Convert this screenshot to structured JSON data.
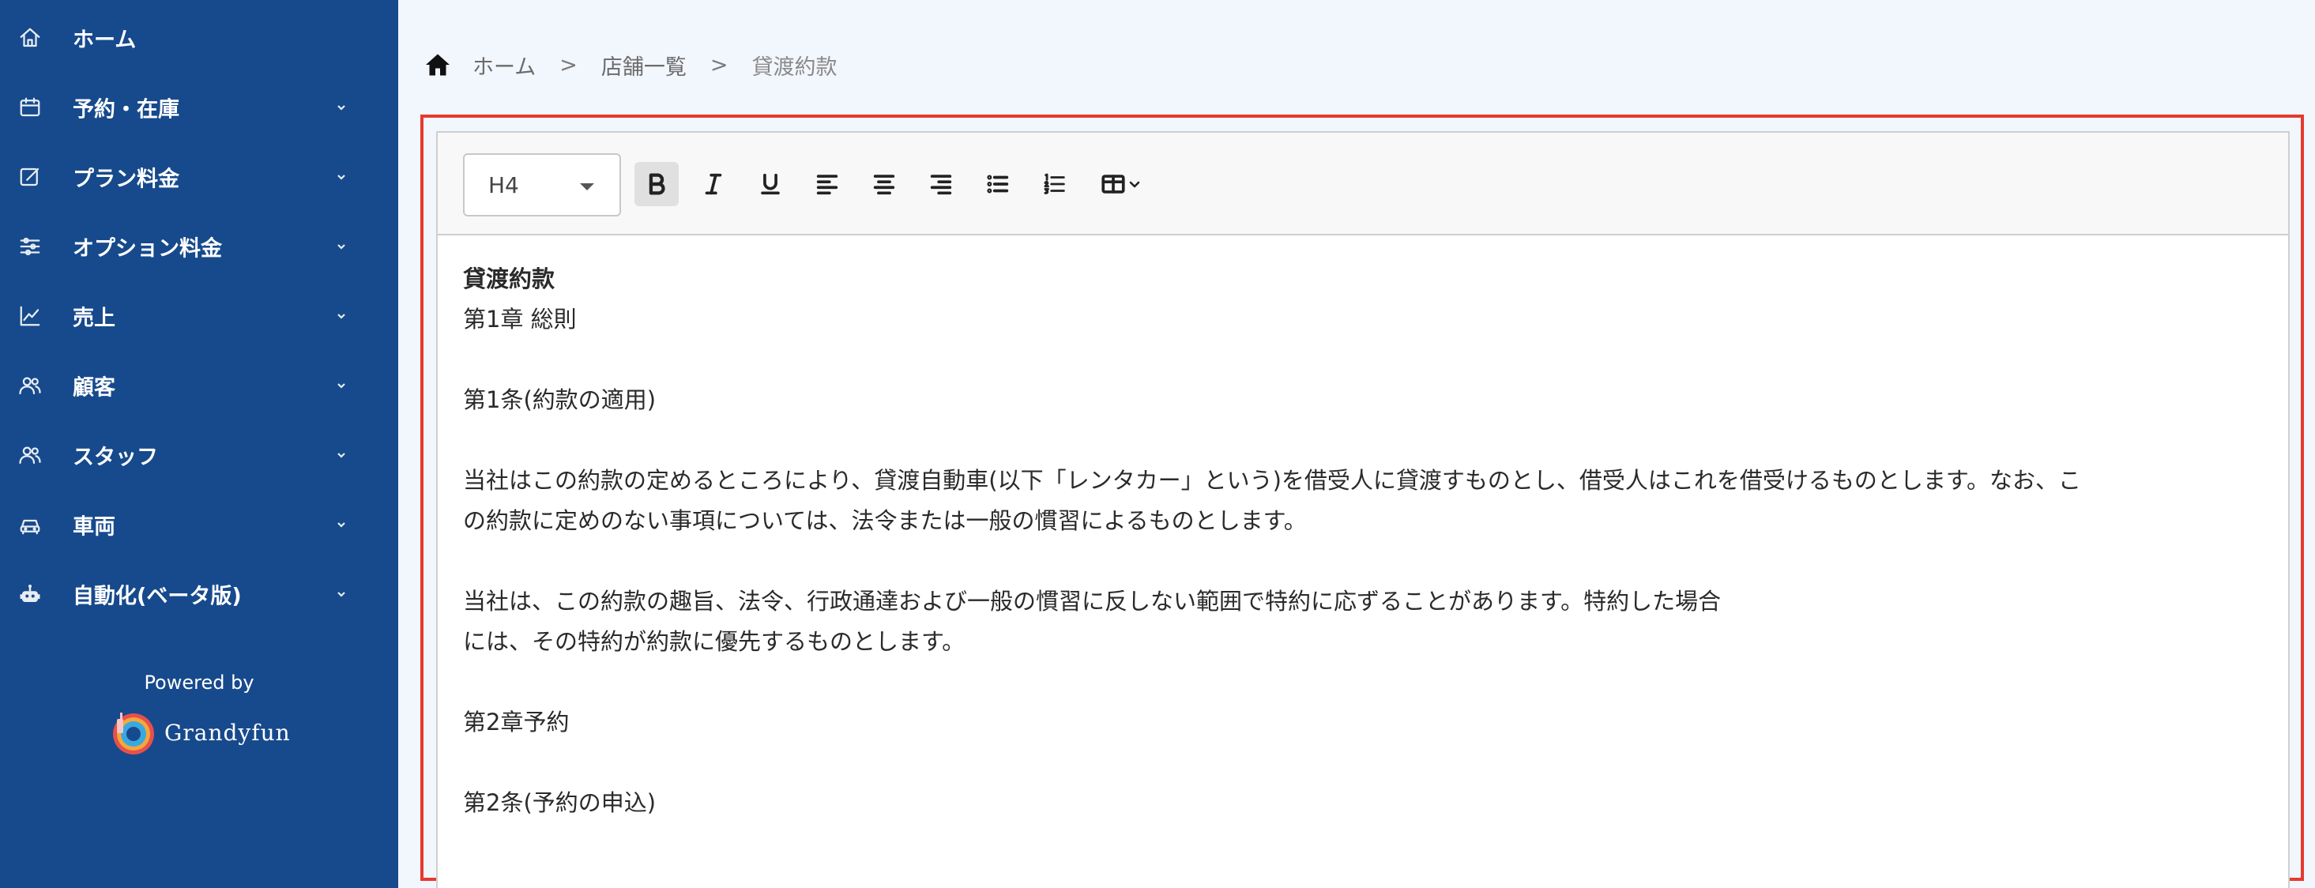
{
  "sidebar": {
    "items": [
      {
        "label": "ホーム",
        "icon": "home-icon",
        "has_chevron": false
      },
      {
        "label": "予約・在庫",
        "icon": "calendar-icon",
        "has_chevron": true
      },
      {
        "label": "プラン料金",
        "icon": "edit-icon",
        "has_chevron": true
      },
      {
        "label": "オプション料金",
        "icon": "sliders-icon",
        "has_chevron": true
      },
      {
        "label": "売上",
        "icon": "chart-line-icon",
        "has_chevron": true
      },
      {
        "label": "顧客",
        "icon": "users-icon",
        "has_chevron": true
      },
      {
        "label": "スタッフ",
        "icon": "users-icon",
        "has_chevron": true
      },
      {
        "label": "車両",
        "icon": "car-icon",
        "has_chevron": true
      },
      {
        "label": "自動化(ベータ版)",
        "icon": "robot-icon",
        "has_chevron": true
      }
    ],
    "powered_by": "Powered by",
    "brand": "Grandyfun"
  },
  "breadcrumb": {
    "home": "ホーム",
    "sep": ">",
    "store_list": "店舗一覧",
    "current": "貸渡約款"
  },
  "editor": {
    "heading_value": "H4",
    "toolbar_icons": [
      "bold-icon",
      "italic-icon",
      "underline-icon",
      "align-left-icon",
      "align-center-icon",
      "align-right-icon",
      "bullet-list-icon",
      "numbered-list-icon",
      "table-icon"
    ],
    "lines": {
      "l1": "貸渡約款",
      "l2": "第1章 総則",
      "l3": "第1条(約款の適用)",
      "l4": "当社はこの約款の定めるところにより、貸渡自動車(以下「レンタカー」という)を借受人に貸渡すものとし、借受人はこれを借受けるものとします。なお、こ",
      "l5": "の約款に定めのない事項については、法令または一般の慣習によるものとします。",
      "l6": "当社は、この約款の趣旨、法令、行政通達および一般の慣習に反しない範囲で特約に応ずることがあります。特約した場合",
      "l7": "には、その特約が約款に優先するものとします。",
      "l8": "第2章予約",
      "l9": "第2条(予約の申込)"
    }
  },
  "colors": {
    "sidebar_bg": "#174a8c",
    "page_bg": "#f2f6fd",
    "highlight_border": "#e53a2f"
  }
}
